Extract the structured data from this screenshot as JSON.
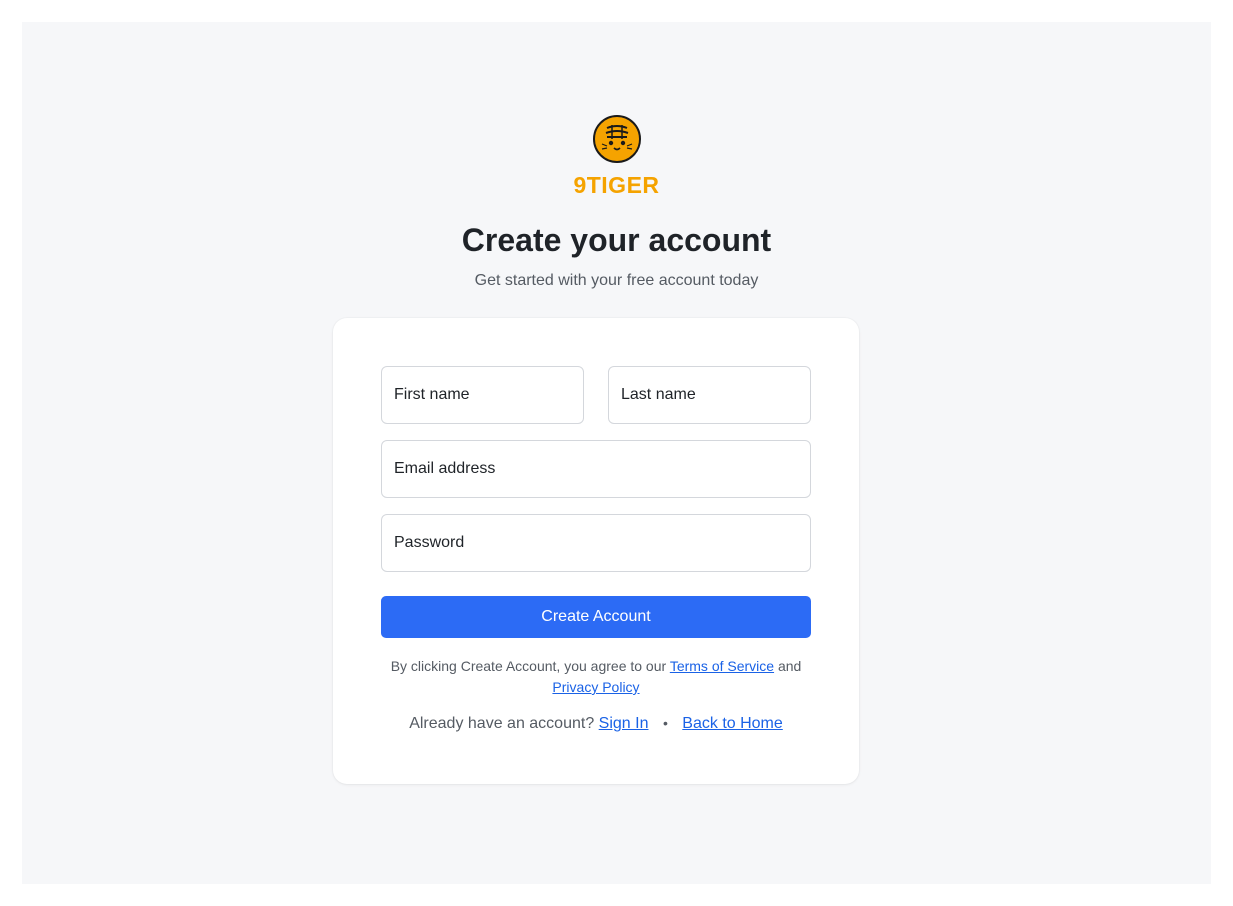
{
  "brand": {
    "name": "9TIGER",
    "logo_icon": "tiger-face-icon",
    "color": "#f5a300"
  },
  "header": {
    "title": "Create your account",
    "subtitle": "Get started with your free account today"
  },
  "form": {
    "first_name_placeholder": "First name",
    "last_name_placeholder": "Last name",
    "email_placeholder": "Email address",
    "password_placeholder": "Password",
    "submit_label": "Create Account"
  },
  "terms": {
    "prefix": "By clicking Create Account, you agree to our",
    "tos_link": "Terms of Service",
    "and": "and",
    "privacy_link": "Privacy Policy"
  },
  "footer": {
    "question": "Already have an account?",
    "sign_in_link": "Sign In",
    "separator": "•",
    "home_link": "Back to Home"
  },
  "colors": {
    "accent": "#2c6bf5",
    "link": "#1a62e6",
    "background": "#f6f7f9"
  }
}
